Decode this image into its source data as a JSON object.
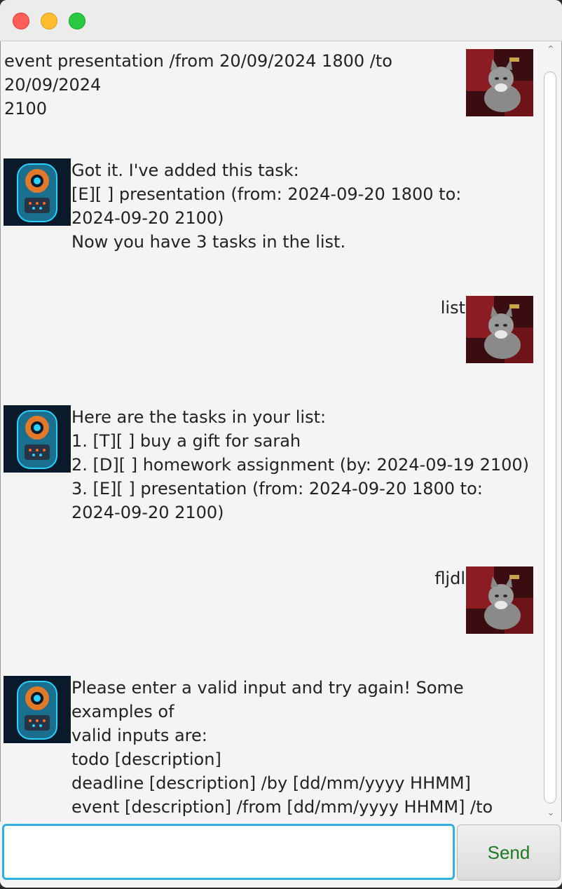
{
  "window": {
    "controls": [
      "close",
      "minimize",
      "maximize"
    ]
  },
  "messages": [
    {
      "sender": "user",
      "text": "event presentation /from 20/09/2024 1800 /to 20/09/2024\n2100"
    },
    {
      "sender": "bot",
      "text": "Got it. I've added this task:\n[E][ ] presentation (from: 2024-09-20 1800 to:\n2024-09-20 2100)\nNow you have 3 tasks in the list."
    },
    {
      "sender": "user",
      "text": "list"
    },
    {
      "sender": "bot",
      "text": "Here are the tasks in your list:\n1. [T][ ] buy a gift for sarah\n2. [D][ ] homework assignment (by: 2024-09-19 2100)\n3. [E][ ] presentation (from: 2024-09-20 1800 to:\n2024-09-20 2100)"
    },
    {
      "sender": "user",
      "text": "fljdl"
    },
    {
      "sender": "bot",
      "text": "Please enter a valid input and try again! Some examples of\nvalid inputs are:\ntodo [description]\ndeadline [description] /by [dd/mm/yyyy HHMM]\nevent [description] /from [dd/mm/yyyy HHMM] /to\n[dd/mm/yyyy HHMM]"
    }
  ],
  "avatars": {
    "user": "cat-photo",
    "bot": "robot-illustration"
  },
  "input": {
    "value": "",
    "placeholder": ""
  },
  "send_button": {
    "label": "Send"
  },
  "colors": {
    "send_text": "#1f7a1f",
    "input_focus_border": "#2fb0e0"
  }
}
